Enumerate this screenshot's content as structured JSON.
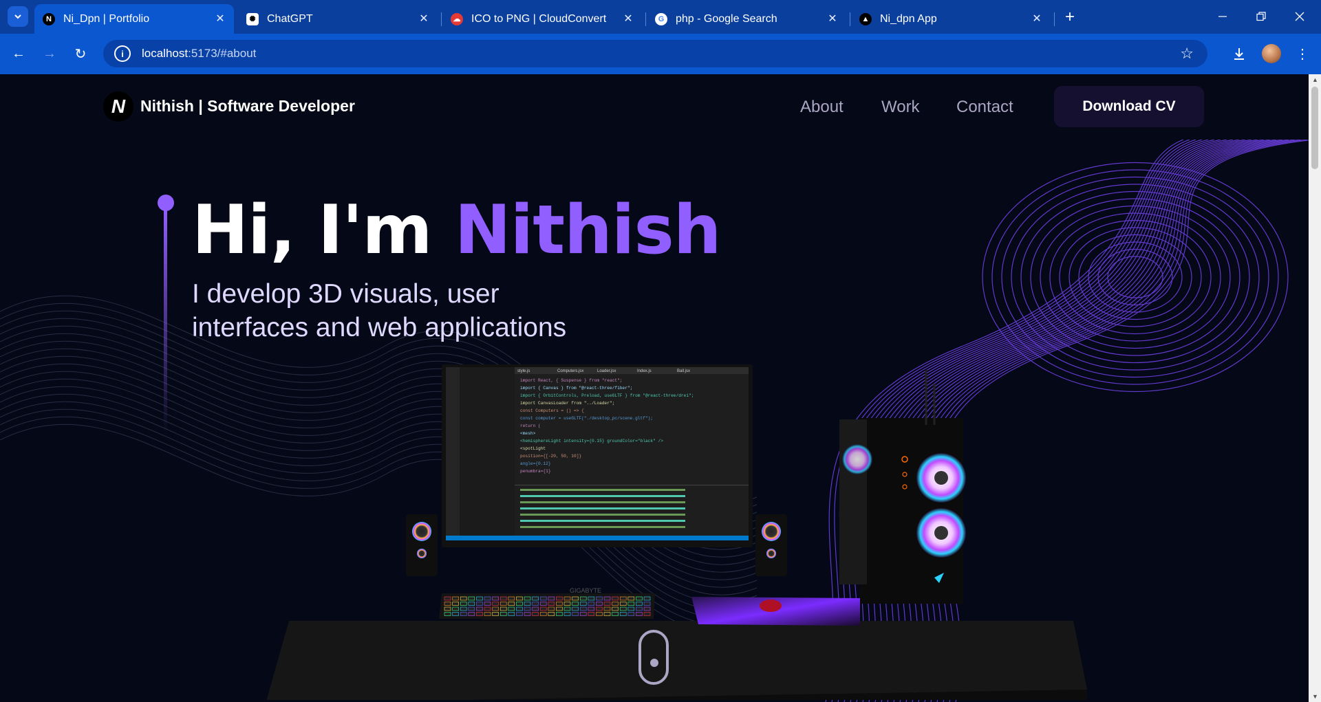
{
  "browser": {
    "tabs": [
      {
        "title": "Ni_Dpn | Portfolio",
        "favicon": "N",
        "active": true
      },
      {
        "title": "ChatGPT",
        "favicon": "gpt"
      },
      {
        "title": "ICO to PNG | CloudConvert",
        "favicon": "cloud"
      },
      {
        "title": "php - Google Search",
        "favicon": "G"
      },
      {
        "title": "Ni_dpn App",
        "favicon": "triangle"
      }
    ],
    "url_host": "localhost",
    "url_rest": ":5173/#about"
  },
  "nav": {
    "logo": "N",
    "brand": "Nithish  | Software Developer",
    "links": [
      "About",
      "Work",
      "Contact"
    ],
    "cv_button": "Download CV"
  },
  "hero": {
    "greeting": "Hi, I'm ",
    "name": "Nithish",
    "subtitle_line1": "I develop 3D visuals, user",
    "subtitle_line2": "interfaces and web applications"
  },
  "scene": {
    "monitor_brand": "GIGABYTE",
    "editor_tabs": [
      "style.js",
      "Computers.jsx",
      "Loader.jsx",
      "Index.js",
      "Ball.jsx"
    ],
    "code_lines": [
      "import React, { Suspense } from \"react\";",
      "import { Canvas } from \"@react-three/fiber\";",
      "import { OrbitControls, Preload, useGLTF } from \"@react-three/drei\";",
      "import CanvasLoader from \"../Loader\";",
      "const Computers = () => {",
      "  const computer = useGLTF(\"./desktop_pc/scene.gltf\");",
      "  return (",
      "    <mesh>",
      "      <hemisphereLight intensity={0.15} groundColor=\"black\" />",
      "      <spotLight",
      "        position={[-20, 50, 10]}",
      "        angle={0.12}",
      "        penumbra={1}"
    ]
  },
  "colors": {
    "accent": "#915eff",
    "background": "#050816",
    "link": "#aaa6c3",
    "chrome": "#0b57d0"
  }
}
